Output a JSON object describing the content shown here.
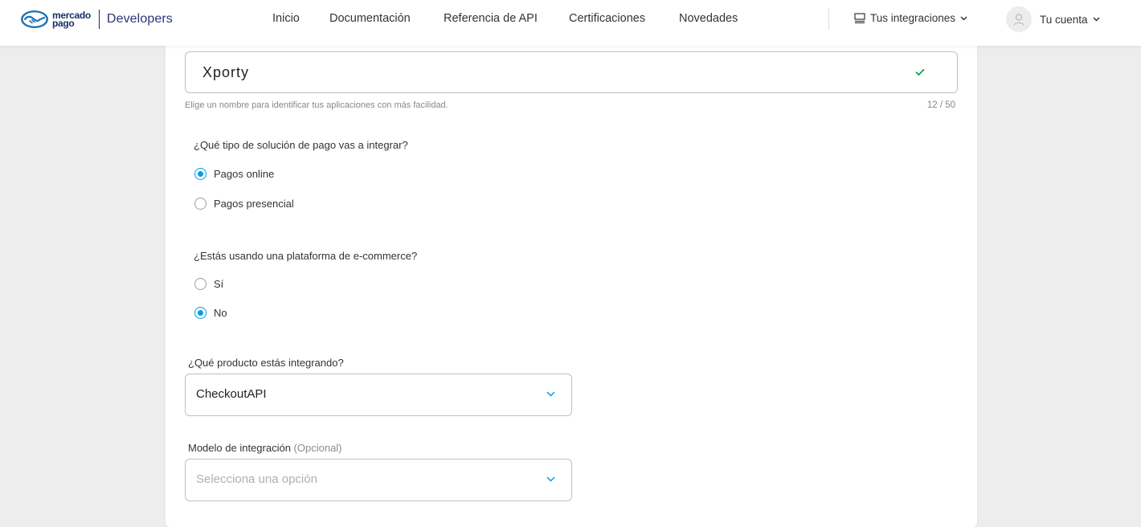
{
  "header": {
    "logo_line1": "mercado",
    "logo_line2": "pago",
    "developers": "Developers",
    "nav": [
      "Inicio",
      "Documentación",
      "Referencia de API",
      "Certificaciones",
      "Novedades"
    ],
    "integrations": "Tus integraciones",
    "account": "Tu cuenta"
  },
  "form": {
    "app_name_value": "Xporty",
    "app_name_helper": "Elige un nombre para identificar tus aplicaciones con más facilidad.",
    "app_name_counter": "12 / 50",
    "q_payment_solution": "¿Qué tipo de solución de pago vas a integrar?",
    "payment_options": [
      {
        "label": "Pagos online",
        "selected": true
      },
      {
        "label": "Pagos presencial",
        "selected": false
      }
    ],
    "q_ecommerce": "¿Estás usando una plataforma de e-commerce?",
    "ecommerce_options": [
      {
        "label": "Sí",
        "selected": false
      },
      {
        "label": "No",
        "selected": true
      }
    ],
    "product_label": "¿Qué producto estás integrando?",
    "product_value": "CheckoutAPI",
    "model_label": "Modelo de integración",
    "model_optional": "(Opcional)",
    "model_placeholder": "Selecciona una opción"
  },
  "colors": {
    "accent": "#009ee3",
    "valid": "#00a650",
    "brand_navy": "#2d3277"
  },
  "icons": {
    "logo": "mercado-pago-handshake-icon",
    "integrations": "monitor-icon",
    "chevron": "chevron-down-icon",
    "avatar": "user-icon",
    "valid": "check-icon"
  }
}
